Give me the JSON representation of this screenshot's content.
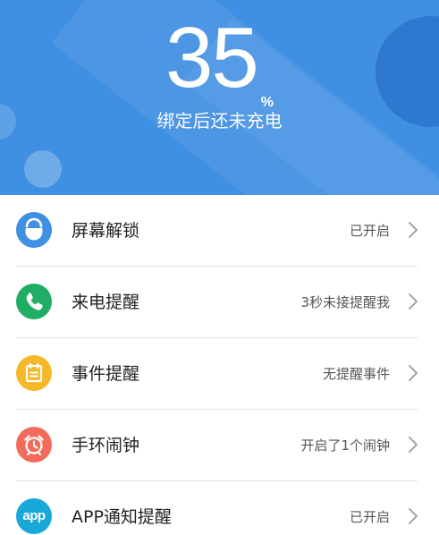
{
  "header": {
    "battery_value": "35",
    "battery_unit": "%",
    "status": "绑定后还未充电"
  },
  "settings": [
    {
      "label": "屏幕解锁",
      "value": "已开启",
      "icon": "unlock-icon",
      "color": "#3f8fe2"
    },
    {
      "label": "来电提醒",
      "value": "3秒未接提醒我",
      "icon": "phone-icon",
      "color": "#1fae63"
    },
    {
      "label": "事件提醒",
      "value": "无提醒事件",
      "icon": "calendar-icon",
      "color": "#f5b82b"
    },
    {
      "label": "手环闹钟",
      "value": "开启了1个闹钟",
      "icon": "alarm-clock-icon",
      "color": "#f26b5b"
    },
    {
      "label": "APP通知提醒",
      "value": "已开启",
      "icon": "app-icon",
      "icon_text": "app",
      "color": "#19a9d8"
    }
  ]
}
